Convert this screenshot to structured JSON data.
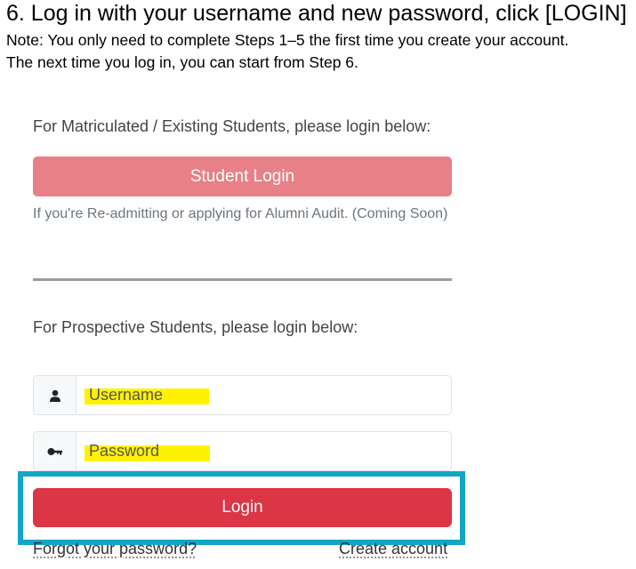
{
  "instructions": {
    "step_title": "6. Log in with your username and new password, click [LOGIN]",
    "note_line1": "Note: You only need to complete Steps 1–5 the first time you create your account.",
    "note_line2": "The next time you log in, you can start from Step 6."
  },
  "login_panel": {
    "matriculated_heading": "For Matriculated / Existing Students, please login below:",
    "student_login_label": "Student Login",
    "readmit_note": "If you're Re-admitting or applying for Alumni Audit. (Coming Soon)",
    "prospective_heading": "For Prospective Students, please login below:",
    "username": {
      "placeholder": "Username",
      "value": "",
      "icon": "user-icon"
    },
    "password": {
      "placeholder": "Password",
      "value": "",
      "icon": "key-icon"
    },
    "login_label": "Login",
    "forgot_password_label": "Forgot your password?",
    "create_account_label": "Create account"
  },
  "colors": {
    "student_login_button": "#e88088",
    "login_button": "#dc3545",
    "callout_border": "#12a6c6",
    "highlight": "#fff200",
    "divider": "#9a9ca0"
  }
}
